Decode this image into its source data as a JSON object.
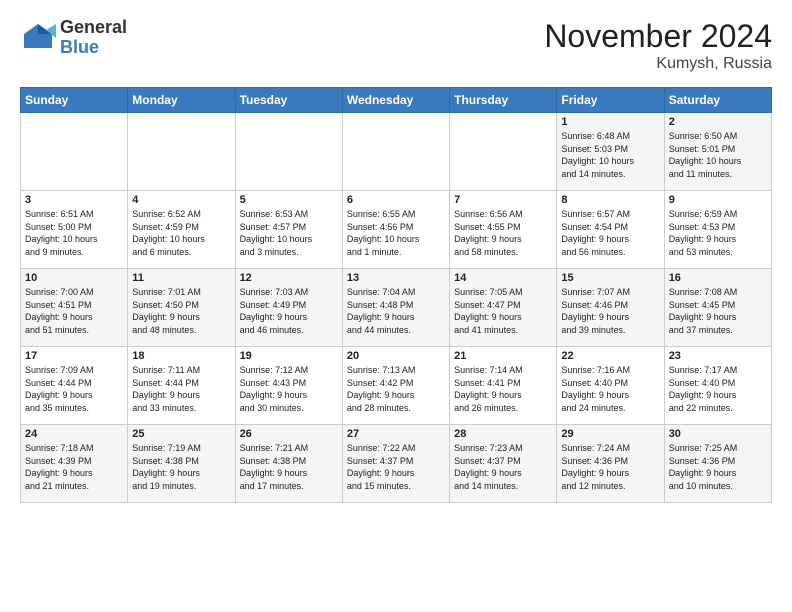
{
  "header": {
    "logo_general": "General",
    "logo_blue": "Blue",
    "month_title": "November 2024",
    "location": "Kumysh, Russia"
  },
  "days_of_week": [
    "Sunday",
    "Monday",
    "Tuesday",
    "Wednesday",
    "Thursday",
    "Friday",
    "Saturday"
  ],
  "weeks": [
    [
      {
        "day": "",
        "info": ""
      },
      {
        "day": "",
        "info": ""
      },
      {
        "day": "",
        "info": ""
      },
      {
        "day": "",
        "info": ""
      },
      {
        "day": "",
        "info": ""
      },
      {
        "day": "1",
        "info": "Sunrise: 6:48 AM\nSunset: 5:03 PM\nDaylight: 10 hours\nand 14 minutes."
      },
      {
        "day": "2",
        "info": "Sunrise: 6:50 AM\nSunset: 5:01 PM\nDaylight: 10 hours\nand 11 minutes."
      }
    ],
    [
      {
        "day": "3",
        "info": "Sunrise: 6:51 AM\nSunset: 5:00 PM\nDaylight: 10 hours\nand 9 minutes."
      },
      {
        "day": "4",
        "info": "Sunrise: 6:52 AM\nSunset: 4:59 PM\nDaylight: 10 hours\nand 6 minutes."
      },
      {
        "day": "5",
        "info": "Sunrise: 6:53 AM\nSunset: 4:57 PM\nDaylight: 10 hours\nand 3 minutes."
      },
      {
        "day": "6",
        "info": "Sunrise: 6:55 AM\nSunset: 4:56 PM\nDaylight: 10 hours\nand 1 minute."
      },
      {
        "day": "7",
        "info": "Sunrise: 6:56 AM\nSunset: 4:55 PM\nDaylight: 9 hours\nand 58 minutes."
      },
      {
        "day": "8",
        "info": "Sunrise: 6:57 AM\nSunset: 4:54 PM\nDaylight: 9 hours\nand 56 minutes."
      },
      {
        "day": "9",
        "info": "Sunrise: 6:59 AM\nSunset: 4:53 PM\nDaylight: 9 hours\nand 53 minutes."
      }
    ],
    [
      {
        "day": "10",
        "info": "Sunrise: 7:00 AM\nSunset: 4:51 PM\nDaylight: 9 hours\nand 51 minutes."
      },
      {
        "day": "11",
        "info": "Sunrise: 7:01 AM\nSunset: 4:50 PM\nDaylight: 9 hours\nand 48 minutes."
      },
      {
        "day": "12",
        "info": "Sunrise: 7:03 AM\nSunset: 4:49 PM\nDaylight: 9 hours\nand 46 minutes."
      },
      {
        "day": "13",
        "info": "Sunrise: 7:04 AM\nSunset: 4:48 PM\nDaylight: 9 hours\nand 44 minutes."
      },
      {
        "day": "14",
        "info": "Sunrise: 7:05 AM\nSunset: 4:47 PM\nDaylight: 9 hours\nand 41 minutes."
      },
      {
        "day": "15",
        "info": "Sunrise: 7:07 AM\nSunset: 4:46 PM\nDaylight: 9 hours\nand 39 minutes."
      },
      {
        "day": "16",
        "info": "Sunrise: 7:08 AM\nSunset: 4:45 PM\nDaylight: 9 hours\nand 37 minutes."
      }
    ],
    [
      {
        "day": "17",
        "info": "Sunrise: 7:09 AM\nSunset: 4:44 PM\nDaylight: 9 hours\nand 35 minutes."
      },
      {
        "day": "18",
        "info": "Sunrise: 7:11 AM\nSunset: 4:44 PM\nDaylight: 9 hours\nand 33 minutes."
      },
      {
        "day": "19",
        "info": "Sunrise: 7:12 AM\nSunset: 4:43 PM\nDaylight: 9 hours\nand 30 minutes."
      },
      {
        "day": "20",
        "info": "Sunrise: 7:13 AM\nSunset: 4:42 PM\nDaylight: 9 hours\nand 28 minutes."
      },
      {
        "day": "21",
        "info": "Sunrise: 7:14 AM\nSunset: 4:41 PM\nDaylight: 9 hours\nand 26 minutes."
      },
      {
        "day": "22",
        "info": "Sunrise: 7:16 AM\nSunset: 4:40 PM\nDaylight: 9 hours\nand 24 minutes."
      },
      {
        "day": "23",
        "info": "Sunrise: 7:17 AM\nSunset: 4:40 PM\nDaylight: 9 hours\nand 22 minutes."
      }
    ],
    [
      {
        "day": "24",
        "info": "Sunrise: 7:18 AM\nSunset: 4:39 PM\nDaylight: 9 hours\nand 21 minutes."
      },
      {
        "day": "25",
        "info": "Sunrise: 7:19 AM\nSunset: 4:38 PM\nDaylight: 9 hours\nand 19 minutes."
      },
      {
        "day": "26",
        "info": "Sunrise: 7:21 AM\nSunset: 4:38 PM\nDaylight: 9 hours\nand 17 minutes."
      },
      {
        "day": "27",
        "info": "Sunrise: 7:22 AM\nSunset: 4:37 PM\nDaylight: 9 hours\nand 15 minutes."
      },
      {
        "day": "28",
        "info": "Sunrise: 7:23 AM\nSunset: 4:37 PM\nDaylight: 9 hours\nand 14 minutes."
      },
      {
        "day": "29",
        "info": "Sunrise: 7:24 AM\nSunset: 4:36 PM\nDaylight: 9 hours\nand 12 minutes."
      },
      {
        "day": "30",
        "info": "Sunrise: 7:25 AM\nSunset: 4:36 PM\nDaylight: 9 hours\nand 10 minutes."
      }
    ]
  ]
}
